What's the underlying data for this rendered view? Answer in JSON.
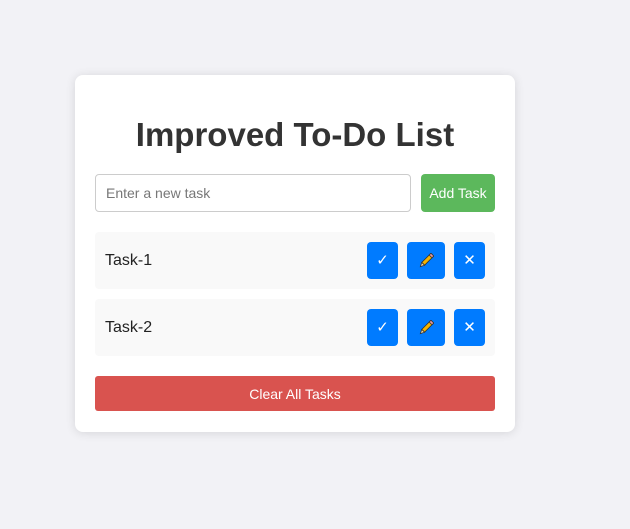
{
  "app": {
    "title": "Improved To-Do List"
  },
  "input": {
    "placeholder": "Enter a new task",
    "value": ""
  },
  "add_button": {
    "label": "Add Task"
  },
  "tasks": [
    {
      "label": "Task-1",
      "complete_icon": "checkmark-icon",
      "edit_icon": "pencil-icon",
      "delete_icon": "close-icon",
      "complete_glyph": "✓",
      "delete_glyph": "✕"
    },
    {
      "label": "Task-2",
      "complete_icon": "checkmark-icon",
      "edit_icon": "pencil-icon",
      "delete_icon": "close-icon",
      "complete_glyph": "✓",
      "delete_glyph": "✕"
    }
  ],
  "clear_button": {
    "label": "Clear All Tasks"
  },
  "colors": {
    "background": "#f2f2f6",
    "card": "#ffffff",
    "add_button": "#5cb85c",
    "action_button": "#007bff",
    "clear_button": "#d9534f",
    "pencil_body": "#f5b400"
  }
}
